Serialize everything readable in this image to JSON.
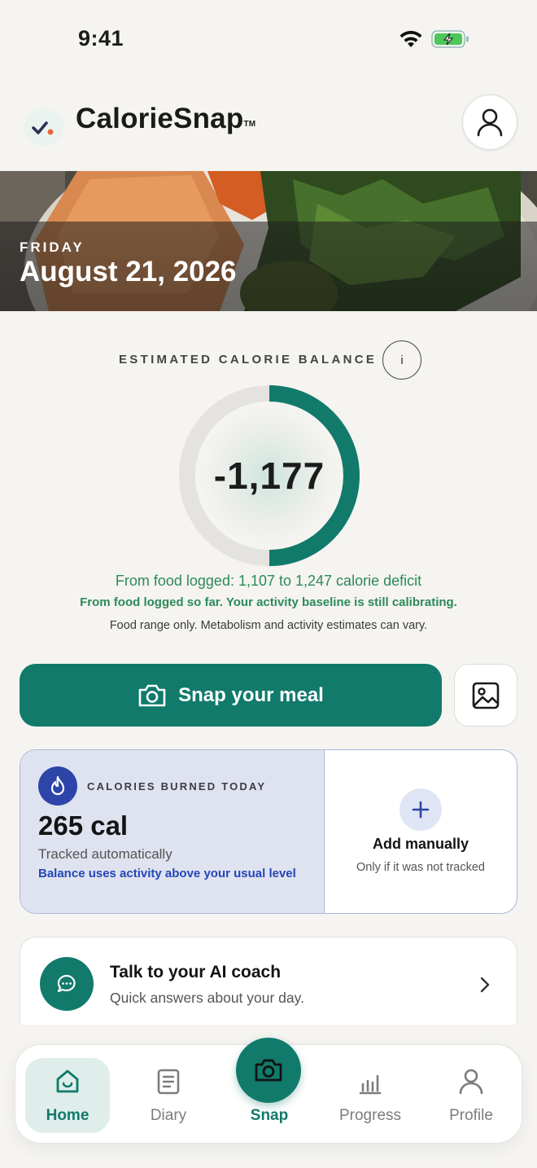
{
  "status_bar": {
    "time": "9:41"
  },
  "header": {
    "app_name": "CalorieSnap",
    "trademark": "TM"
  },
  "hero": {
    "day": "FRIDAY",
    "date": "August 21, 2026"
  },
  "balance": {
    "label": "ESTIMATED CALORIE BALANCE",
    "info_label": "i",
    "value": "-1,177",
    "ring_fill_fraction": 0.5,
    "deficit_text": "From food logged: 1,107 to 1,247 calorie deficit",
    "calibrate_text": "From food logged so far. Your activity baseline is still calibrating.",
    "disclaimer": "Food range only. Metabolism and activity estimates can vary."
  },
  "actions": {
    "snap_label": "Snap your meal"
  },
  "burned": {
    "label": "CALORIES BURNED TODAY",
    "value": "265 cal",
    "sub": "Tracked automatically",
    "note": "Balance uses activity above your usual level",
    "add_title": "Add manually",
    "add_sub": "Only if it was not tracked"
  },
  "coach": {
    "title": "Talk to your AI coach",
    "sub": "Quick answers about your day."
  },
  "nav": {
    "home": "Home",
    "diary": "Diary",
    "snap": "Snap",
    "progress": "Progress",
    "profile": "Profile"
  },
  "colors": {
    "accent": "#117a6b",
    "deficit_text": "#2c8a5a",
    "burned_bg": "#dfe3ef",
    "burned_accent": "#2d45a8"
  }
}
